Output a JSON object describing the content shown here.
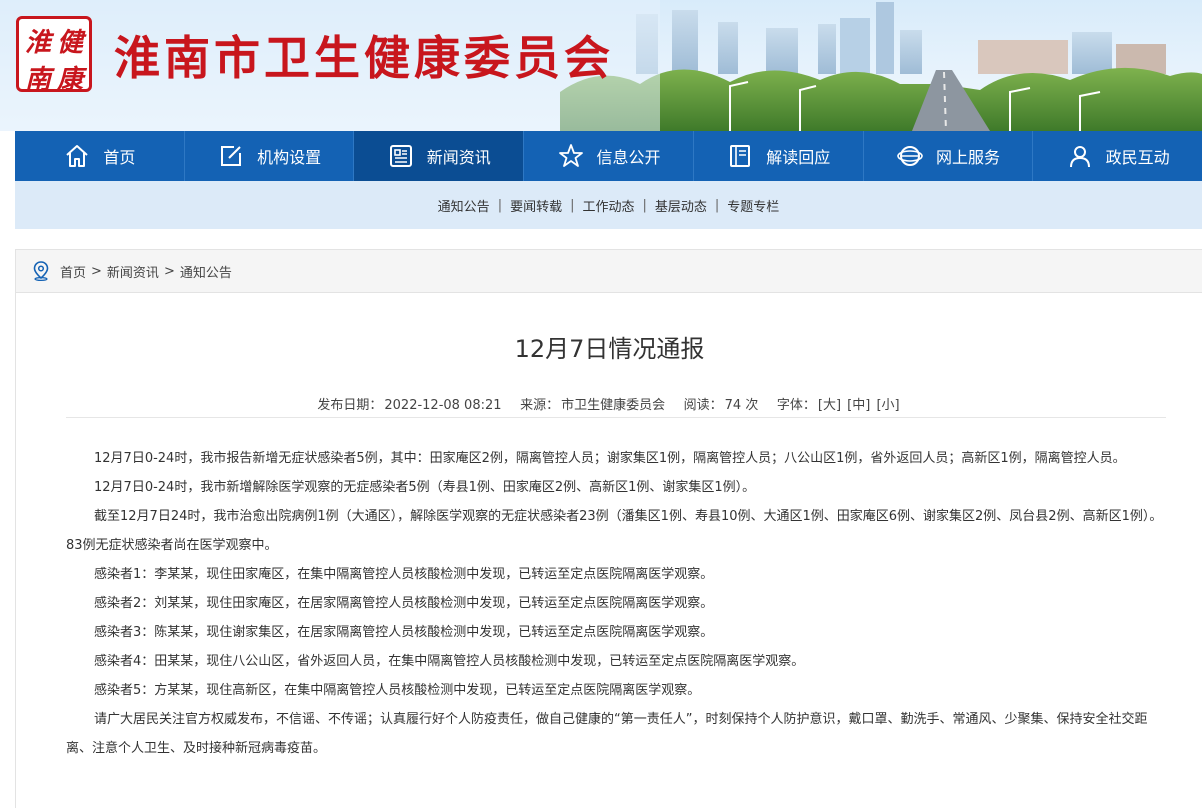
{
  "header": {
    "seal_chars": [
      "淮",
      "健",
      "南",
      "康"
    ],
    "site_title": "淮南市卫生健康委员会",
    "brand_color": "#c8161d"
  },
  "nav": {
    "items": [
      {
        "label": "首页",
        "icon": "home-icon"
      },
      {
        "label": "机构设置",
        "icon": "edit-icon"
      },
      {
        "label": "新闻资讯",
        "icon": "newspaper-icon",
        "active": true
      },
      {
        "label": "信息公开",
        "icon": "star-icon"
      },
      {
        "label": "解读回应",
        "icon": "book-icon"
      },
      {
        "label": "网上服务",
        "icon": "globe-icon"
      },
      {
        "label": "政民互动",
        "icon": "user-icon"
      }
    ],
    "color": "#1462b4",
    "active_color": "#0b4d93"
  },
  "subnav": {
    "items": [
      "通知公告",
      "要闻转载",
      "工作动态",
      "基层动态",
      "专题专栏"
    ]
  },
  "breadcrumb": {
    "icon": "location-pin-icon",
    "items": [
      "首页",
      "新闻资讯",
      "通知公告"
    ],
    "separator": ">"
  },
  "article": {
    "title": "12月7日情况通报",
    "meta": {
      "date_label": "发布日期：",
      "date": "2022-12-08 08:21",
      "source_label": "来源：",
      "source": "市卫生健康委员会",
      "views_label": "阅读：",
      "views": "74 次",
      "font_label": "字体：",
      "font_sizes": [
        "[大]",
        "[中]",
        "[小]"
      ]
    },
    "paragraphs": [
      "12月7日0-24时，我市报告新增无症状感染者5例，其中：田家庵区2例，隔离管控人员；谢家集区1例，隔离管控人员；八公山区1例，省外返回人员；高新区1例，隔离管控人员。",
      "12月7日0-24时，我市新增解除医学观察的无症感染者5例（寿县1例、田家庵区2例、高新区1例、谢家集区1例）。",
      "截至12月7日24时，我市治愈出院病例1例（大通区），解除医学观察的无症状感染者23例（潘集区1例、寿县10例、大通区1例、田家庵区6例、谢家集区2例、凤台县2例、高新区1例）。83例无症状感染者尚在医学观察中。",
      "感染者1：李某某，现住田家庵区，在集中隔离管控人员核酸检测中发现，已转运至定点医院隔离医学观察。",
      "感染者2：刘某某，现住田家庵区，在居家隔离管控人员核酸检测中发现，已转运至定点医院隔离医学观察。",
      "感染者3：陈某某，现住谢家集区，在居家隔离管控人员核酸检测中发现，已转运至定点医院隔离医学观察。",
      "感染者4：田某某，现住八公山区，省外返回人员，在集中隔离管控人员核酸检测中发现，已转运至定点医院隔离医学观察。",
      "感染者5：方某某，现住高新区，在集中隔离管控人员核酸检测中发现，已转运至定点医院隔离医学观察。",
      "请广大居民关注官方权威发布，不信谣、不传谣；认真履行好个人防疫责任，做自己健康的“第一责任人”，时刻保持个人防护意识，戴口罩、勤洗手、常通风、少聚集、保持安全社交距离、注意个人卫生、及时接种新冠病毒疫苗。"
    ]
  }
}
